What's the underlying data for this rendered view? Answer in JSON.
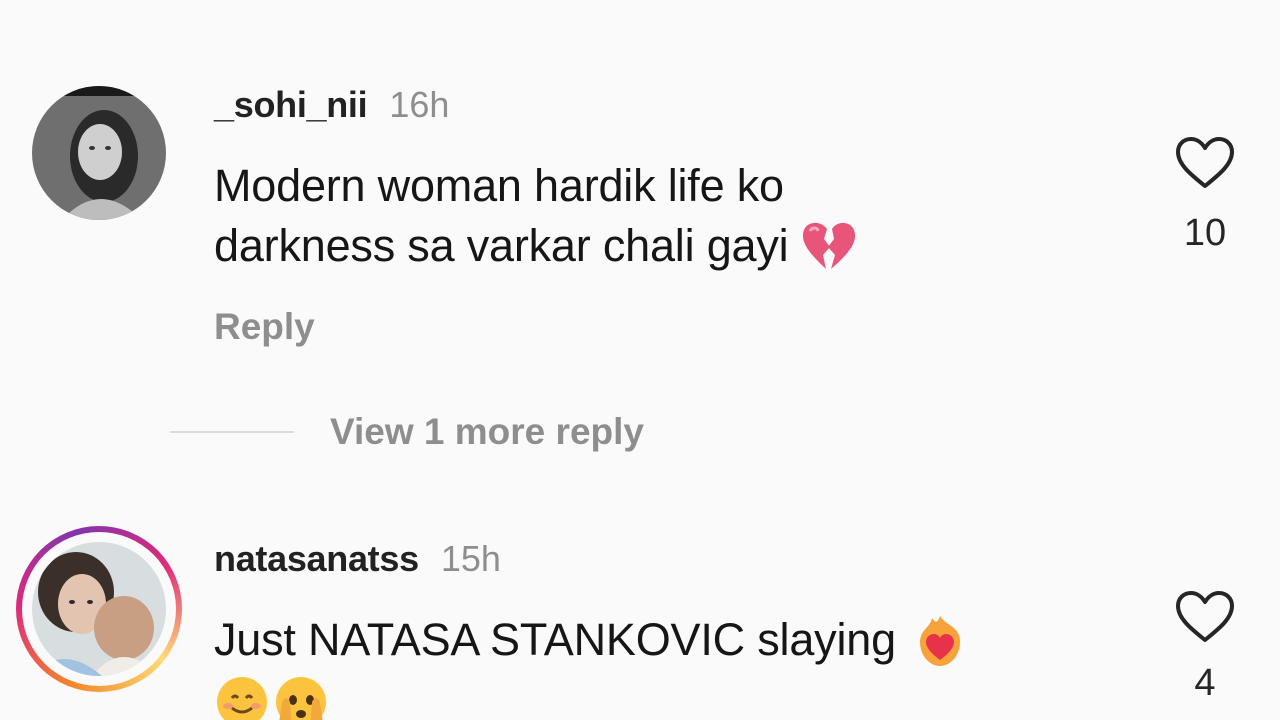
{
  "comments": [
    {
      "username": "_sohi_nii",
      "time": "16h",
      "line1": "Modern woman hardik life ko",
      "line2": "darkness sa varkar chali gayi",
      "emoji": "broken-heart-icon",
      "reply_label": "Reply",
      "likes": "10"
    },
    {
      "username": "natasanatss",
      "time": "15h",
      "line1": "Just NATASA STANKOVIC slaying",
      "emoji": [
        "heart-on-fire-icon",
        "smiling-face-icon",
        "face-peeking-icon"
      ],
      "likes": "4"
    }
  ],
  "view_more_label": "View 1 more reply",
  "colors": {
    "background": "#fafafa",
    "username": "#222222",
    "secondary_text": "#8e8e8e",
    "broken_heart": "#e8557a",
    "story_ring": [
      "#f58529",
      "#dd2a7b",
      "#8134af"
    ]
  }
}
